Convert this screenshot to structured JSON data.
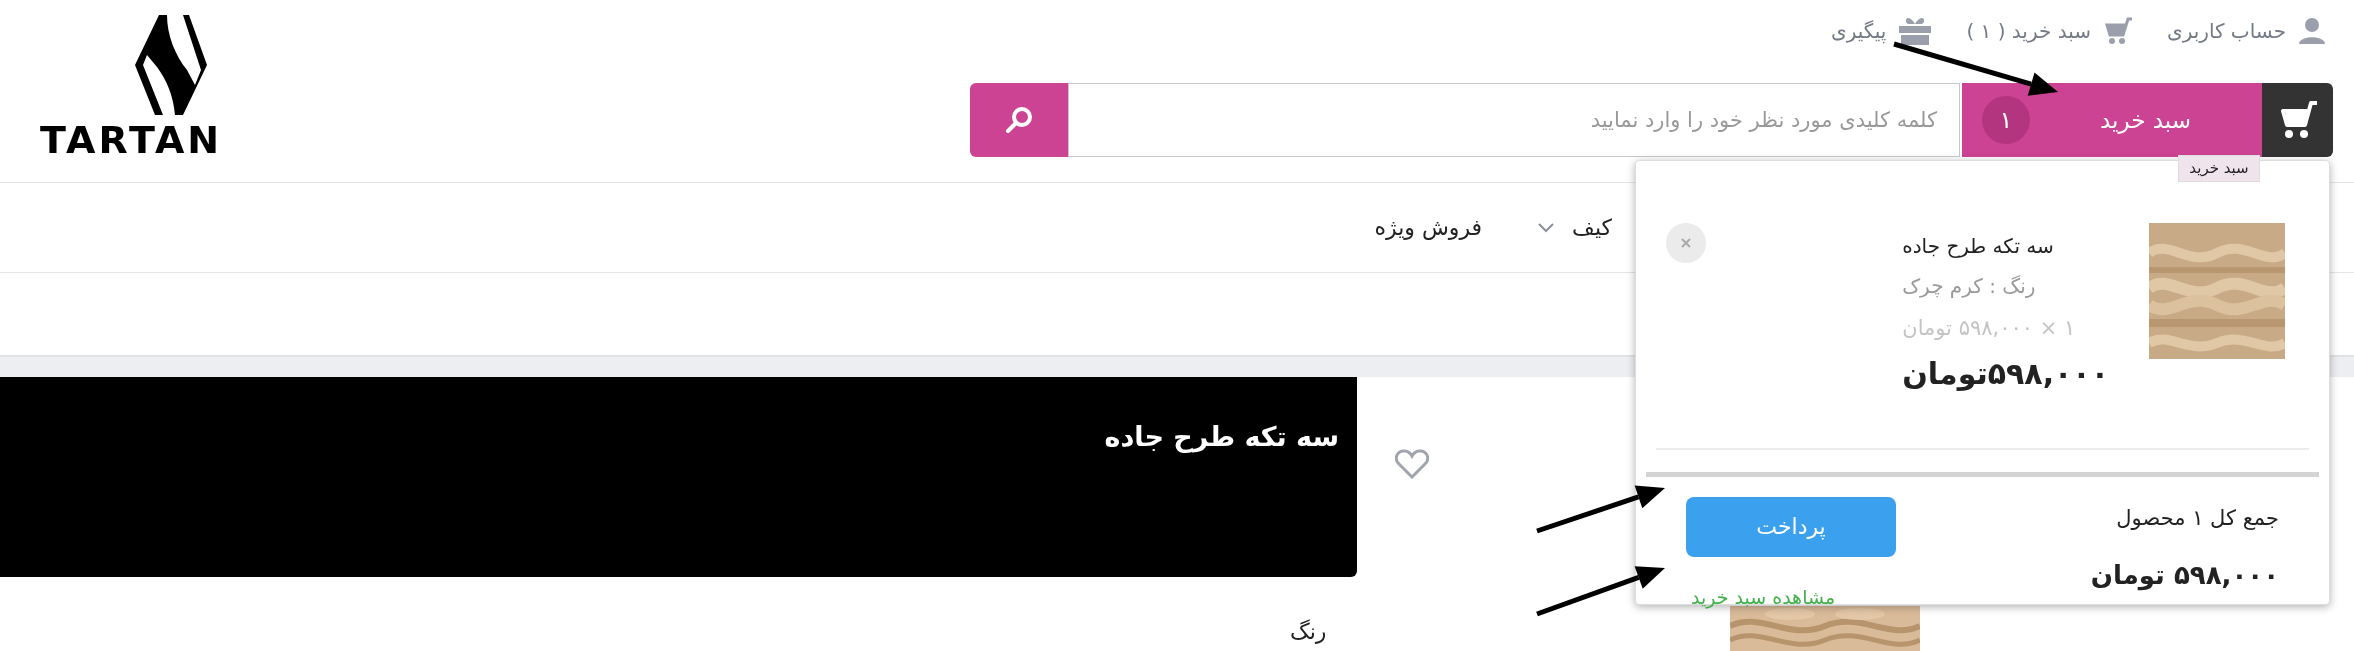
{
  "top_links": [
    {
      "kind": "account",
      "label": "حساب کاربری"
    },
    {
      "kind": "cart",
      "label": "سبد خرید ( ۱ )"
    },
    {
      "kind": "tracking",
      "label": "پیگیری"
    }
  ],
  "logo": {
    "text": "TARTAN"
  },
  "search": {
    "placeholder": "کلمه کلیدی مورد نظر خود را وارد نمایید"
  },
  "cart_button": {
    "label": "سبد خرید",
    "count": "۱"
  },
  "tooltip": "سبد خرید",
  "nav": [
    {
      "label": "کیف",
      "has_dropdown": true
    },
    {
      "label": "فروش ویژه",
      "has_dropdown": false
    }
  ],
  "product": {
    "title": "سه تکه طرح جاده",
    "option_label": "رنگ",
    "favorite": false
  },
  "cart_dropdown": {
    "items": [
      {
        "title": "سه تکه طرح جاده",
        "variant": "رنگ : کرم چرک",
        "quantity_price": "۱ × ۵۹۸,۰۰۰ تومان",
        "price": "۵۹۸,۰۰۰تومان"
      }
    ],
    "total_label": "جمع کل ۱ محصول",
    "total": "۵۹۸,۰۰۰ تومان",
    "checkout_button": "پرداخت",
    "view_cart_link": "مشاهده سبد خرید"
  }
}
